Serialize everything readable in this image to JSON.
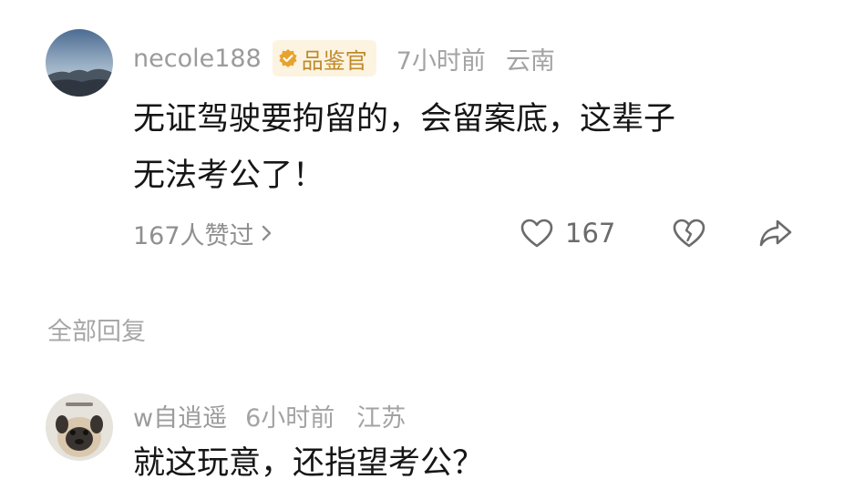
{
  "comment": {
    "username": "necole188",
    "badge": "品鉴官",
    "time": "7小时前",
    "location": "云南",
    "text_line1": "无证驾驶要拘留的，会留案底，这辈子",
    "text_line2": "无法考公了！",
    "liked_by": "167人赞过",
    "like_count": "167",
    "icons": [
      "avatar-landscape",
      "badge-check-icon",
      "chevron-right-icon",
      "heart-icon",
      "broken-heart-icon",
      "share-icon"
    ]
  },
  "replies_section": {
    "title": "全部回复"
  },
  "reply": {
    "username": "w自逍遥",
    "time": "6小时前",
    "location": "江苏",
    "text": "就这玩意，还指望考公？"
  },
  "colors": {
    "username": "#9b9b9b",
    "meta": "#a3a3a3",
    "text": "#161616",
    "badge_bg": "#fcf4e1",
    "badge_text": "#c08a2c"
  }
}
